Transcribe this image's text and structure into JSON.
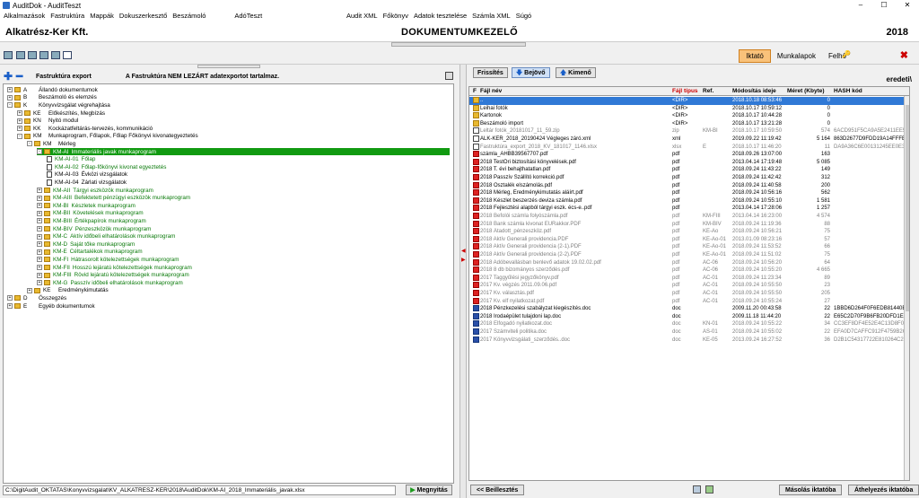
{
  "window": {
    "title": "AuditDok - AuditTeszt",
    "min": "–",
    "max": "☐",
    "close": "✕"
  },
  "menu": {
    "left": [
      "Alkalmazások",
      "Fastruktúra",
      "Mappák",
      "Dokuszerkesztő",
      "Beszámoló",
      "AdóTeszt"
    ],
    "right": [
      "Audit XML",
      "Főkönyv",
      "Adatok tesztelése",
      "Számla XML",
      "Súgó"
    ]
  },
  "header": {
    "company": "Alkatrész-Ker Kft.",
    "module": "DOKUMENTUMKEZELŐ",
    "year": "2018"
  },
  "tabs": [
    "Iktató",
    "Munkalapok",
    "Felhő"
  ],
  "left": {
    "label": "Fastruktúra export",
    "notice": "A Fastruktúra NEM LEZÁRT adatexportot tartalmaz.",
    "path": "C:\\DigitAudit_OKTATAS\\Konyvvizsgalat\\KV_ALKATRESZ-KER\\2018\\AuditDok\\KM-AI_2018_Immateriális_javak.xlsx",
    "open": "Megnyitás"
  },
  "tree": [
    {
      "lvl": 0,
      "exp": "+",
      "code": "A",
      "label": "Állandó dokumentumok"
    },
    {
      "lvl": 0,
      "exp": "+",
      "code": "B",
      "label": "Beszámoló és elemzés"
    },
    {
      "lvl": 0,
      "exp": "-",
      "code": "K",
      "label": "Könyvvizsgálat végrehajtása"
    },
    {
      "lvl": 1,
      "exp": "+",
      "code": "KE",
      "label": "Előkészítés, Megbízás"
    },
    {
      "lvl": 1,
      "exp": "+",
      "code": "KN",
      "label": "Nyitó modul"
    },
    {
      "lvl": 1,
      "exp": "+",
      "code": "KK",
      "label": "Kockázatfeltárás-tervezés, kommunikáció"
    },
    {
      "lvl": 1,
      "exp": "-",
      "code": "KM",
      "label": "Munkaprogram, Főlapok, Főlap Főkönyvi kivonategyeztetés"
    },
    {
      "lvl": 2,
      "exp": "-",
      "code": "KM",
      "label": "Mérleg"
    },
    {
      "lvl": 3,
      "exp": "-",
      "code": "KM-AI",
      "label": "Immateriális javak munkaprogram",
      "sel": true
    },
    {
      "lvl": 4,
      "doc": true,
      "code": "KM-AI-01",
      "label": "Főlap",
      "green": true
    },
    {
      "lvl": 4,
      "doc": true,
      "code": "KM-AI-02",
      "label": "Főlap-főkönyvi kivonat egyeztetés",
      "green": true
    },
    {
      "lvl": 4,
      "doc": true,
      "code": "KM-AI-03",
      "label": "Évközi vizsgálatok"
    },
    {
      "lvl": 4,
      "doc": true,
      "code": "KM-AI-04",
      "label": "Zárlati vizsgálatok"
    },
    {
      "lvl": 3,
      "exp": "+",
      "code": "KM-AII",
      "label": "Tárgyi eszközök munkaprogram",
      "green": true
    },
    {
      "lvl": 3,
      "exp": "+",
      "code": "KM-AIII",
      "label": "Befektetett pénzügyi eszközök munkaprogram",
      "green": true
    },
    {
      "lvl": 3,
      "exp": "+",
      "code": "KM-BI",
      "label": "Készletek munkaprogram",
      "green": true
    },
    {
      "lvl": 3,
      "exp": "+",
      "code": "KM-BII",
      "label": "Követelések munkaprogram",
      "green": true
    },
    {
      "lvl": 3,
      "exp": "+",
      "code": "KM-BIII",
      "label": "Értékpapírok munkaprogram",
      "green": true
    },
    {
      "lvl": 3,
      "exp": "+",
      "code": "KM-BIV",
      "label": "Pénzeszközök munkaprogram",
      "green": true
    },
    {
      "lvl": 3,
      "exp": "+",
      "code": "KM-C",
      "label": "Aktív időbeli elhatárolások munkaprogram",
      "green": true
    },
    {
      "lvl": 3,
      "exp": "+",
      "code": "KM-D",
      "label": "Saját tőke munkaprogram",
      "green": true
    },
    {
      "lvl": 3,
      "exp": "+",
      "code": "KM-E",
      "label": "Céltartalékok munkaprogram",
      "green": true
    },
    {
      "lvl": 3,
      "exp": "+",
      "code": "KM-FI",
      "label": "Hátrasorolt kötelezettségek munkaprogram",
      "green": true
    },
    {
      "lvl": 3,
      "exp": "+",
      "code": "KM-FII",
      "label": "Hosszú lejáratú kötelezettségek munkaprogram",
      "green": true
    },
    {
      "lvl": 3,
      "exp": "+",
      "code": "KM-FIII",
      "label": "Rövid lejáratú kötelezettségek munkaprogram",
      "green": true
    },
    {
      "lvl": 3,
      "exp": "+",
      "code": "KM-G",
      "label": "Passzív időbeli elhatárolások munkaprogram",
      "green": true
    },
    {
      "lvl": 2,
      "exp": "+",
      "code": "KE",
      "label": "Eredménykimutatás"
    },
    {
      "lvl": 0,
      "exp": "+",
      "code": "D",
      "label": "Összegzés"
    },
    {
      "lvl": 0,
      "exp": "+",
      "code": "E",
      "label": "Egyéb dokumentumok"
    }
  ],
  "right": {
    "refresh": "Frissítés",
    "incoming": "Bejövő",
    "outgoing": "Kimenő",
    "original": "eredeti\\",
    "back": "<< Beillesztés",
    "copy": "Másolás iktatóba",
    "move": "Áthelyezés iktatóba"
  },
  "columns": [
    "F",
    "Fájl név",
    "Fájl típus",
    "Ref.",
    "Módosítás ideje",
    "Méret (Kbyte)",
    "HASH kód"
  ],
  "files": [
    {
      "ic": "up",
      "name": "..",
      "type": "<DIR>",
      "ref": "",
      "date": "2018.10.18 08:53:46",
      "size": "0",
      "hash": "",
      "sel": true
    },
    {
      "ic": "folder",
      "name": "Leihai fotók",
      "type": "<DIR>",
      "ref": "",
      "date": "2018.10.17 10:59:12",
      "size": "0",
      "hash": ""
    },
    {
      "ic": "folder",
      "name": "Kartonok",
      "type": "<DIR>",
      "ref": "",
      "date": "2018.10.17 10:44:28",
      "size": "0",
      "hash": ""
    },
    {
      "ic": "folder",
      "name": "Beszámoló import",
      "type": "<DIR>",
      "ref": "",
      "date": "2018.10.17 13:21:28",
      "size": "0",
      "hash": ""
    },
    {
      "ic": "xml",
      "name": "Leltár fotók_20181017_11_59.zip",
      "type": "zip",
      "ref": "KM-BI",
      "date": "2018.10.17 10:59:50",
      "size": "574",
      "hash": "6ACD951F5CA9A5E2411EE56",
      "gray": true
    },
    {
      "ic": "xml",
      "name": "ALK-KER_2018_20190424 Végleges záró.xml",
      "type": "xml",
      "ref": "",
      "date": "2019.09.22 11:19:42",
      "size": "5 164",
      "hash": "863D2677D9FDD19A14FFFBFB"
    },
    {
      "ic": "xml",
      "name": "Fastruktúra_export_2018_KV_181017_1146.xlsx",
      "type": "xlsx",
      "ref": "E",
      "date": "2018.10.17 11:46:20",
      "size": "11",
      "hash": "DA9A36C6E00131245EE0E3F",
      "gray": true
    },
    {
      "ic": "pdf",
      "name": "számla_AHBB39567707.pdf",
      "type": "pdf",
      "ref": "",
      "date": "2018.09.26 13:07:00",
      "size": "163",
      "hash": ""
    },
    {
      "ic": "pdf",
      "name": "2018 TestÖri biztosítási könyvelések.pdf",
      "type": "pdf",
      "ref": "",
      "date": "2013.04.14 17:19:48",
      "size": "5 085",
      "hash": ""
    },
    {
      "ic": "pdf",
      "name": "2018 T. évi behajthatatlan.pdf",
      "type": "pdf",
      "ref": "",
      "date": "2018.09.24 11:43:22",
      "size": "149",
      "hash": ""
    },
    {
      "ic": "pdf",
      "name": "2018 Passzív Szállító korrekció.pdf",
      "type": "pdf",
      "ref": "",
      "date": "2018.09.24 11:42:42",
      "size": "312",
      "hash": ""
    },
    {
      "ic": "pdf",
      "name": "2018 Osztalék elszámolás.pdf",
      "type": "pdf",
      "ref": "",
      "date": "2018.09.24 11:40:58",
      "size": "200",
      "hash": ""
    },
    {
      "ic": "pdf",
      "name": "2018 Mérleg, Eredménykimutatás aláírt.pdf",
      "type": "pdf",
      "ref": "",
      "date": "2018.09.24 10:56:16",
      "size": "562",
      "hash": ""
    },
    {
      "ic": "pdf",
      "name": "2018 Készlet beszerzés deviza számla.pdf",
      "type": "pdf",
      "ref": "",
      "date": "2018.09.24 10:55:10",
      "size": "1 581",
      "hash": ""
    },
    {
      "ic": "pdf",
      "name": "2018 Fejlesztési alapból tárgyi eszk. écs-e..pdf",
      "type": "pdf",
      "ref": "",
      "date": "2013.04.14 17:28:06",
      "size": "1 257",
      "hash": ""
    },
    {
      "ic": "pdf",
      "name": "2018 Befolói számla folyószámla.pdf",
      "type": "pdf",
      "ref": "KM-FIII",
      "date": "2013.04.14 16:23:00",
      "size": "4 574",
      "hash": "",
      "gray": true
    },
    {
      "ic": "pdf",
      "name": "2018 Bank számla kivonat EURakkor.PDF",
      "type": "pdf",
      "ref": "KM-BIV",
      "date": "2018.09.24 11:19:36",
      "size": "88",
      "hash": "",
      "gray": true
    },
    {
      "ic": "pdf",
      "name": "2018 Átadott_pénzeszköz.pdf",
      "type": "pdf",
      "ref": "KE-Ao",
      "date": "2018.09.24 10:56:21",
      "size": "75",
      "hash": "",
      "gray": true
    },
    {
      "ic": "pdf",
      "name": "2018 Aktív Generali providencia.PDF",
      "type": "pdf",
      "ref": "KE-Ao-01",
      "date": "2013.01.09 08:23:16",
      "size": "57",
      "hash": "",
      "gray": true
    },
    {
      "ic": "pdf",
      "name": "2018 Aktív Generali providencia (2-1).PDF",
      "type": "pdf",
      "ref": "KE-Ao-01",
      "date": "2018.09.24 11:53:52",
      "size": "66",
      "hash": "",
      "gray": true
    },
    {
      "ic": "pdf",
      "name": "2018 Aktív Generali providencia (2-2).PDF",
      "type": "pdf",
      "ref": "KE-Ao-01",
      "date": "2018.09.24 11:51:02",
      "size": "75",
      "hash": "",
      "gray": true
    },
    {
      "ic": "pdf",
      "name": "2018 Adóbevallásban benlevő adatok 19.02.02.pdf",
      "type": "pdf",
      "ref": "AC-06",
      "date": "2018.09.24 10:56:20",
      "size": "64",
      "hash": "",
      "gray": true
    },
    {
      "ic": "pdf",
      "name": "2018 8 db bizományos szerződés.pdf",
      "type": "pdf",
      "ref": "AC-06",
      "date": "2018.09.24 10:55:20",
      "size": "4 665",
      "hash": "",
      "gray": true
    },
    {
      "ic": "pdf",
      "name": "2017 Taggyűlési jegyzőkönyv.pdf",
      "type": "pdf",
      "ref": "AC-01",
      "date": "2018.09.24 11:23:34",
      "size": "89",
      "hash": "",
      "gray": true
    },
    {
      "ic": "pdf",
      "name": "2017 Kv. végzés 2011.09.06.pdf",
      "type": "pdf",
      "ref": "AC-01",
      "date": "2018.09.24 10:55:50",
      "size": "23",
      "hash": "",
      "gray": true
    },
    {
      "ic": "pdf",
      "name": "2017 Kv. választás.pdf",
      "type": "pdf",
      "ref": "AC-01",
      "date": "2018.09.24 10:55:50",
      "size": "205",
      "hash": "",
      "gray": true
    },
    {
      "ic": "pdf",
      "name": "2017 Kv. elf nyilatkozat.pdf",
      "type": "pdf",
      "ref": "AC-01",
      "date": "2018.09.24 10:55:24",
      "size": "27",
      "hash": "",
      "gray": true
    },
    {
      "ic": "docx",
      "name": "2018 Pénzkezelési szabályzat kiegészítés.doc",
      "type": "doc",
      "ref": "",
      "date": "2009.11.20 00:43:58",
      "size": "22",
      "hash": "1BBD6D264F0F6EDB81440E2"
    },
    {
      "ic": "docx",
      "name": "2018 Irodaépület tulajdoni lap.doc",
      "type": "doc",
      "ref": "",
      "date": "2009.11.18 11:44:20",
      "size": "22",
      "hash": "E65C2D70F9B6FB20DFD1E6F3"
    },
    {
      "ic": "docx",
      "name": "2018 Elfogadó nyilatkozat.doc",
      "type": "doc",
      "ref": "KN-01",
      "date": "2018.09.24 10:55:22",
      "size": "34",
      "hash": "CC3EF8DF4E52E4C13D8F0E3",
      "gray": true
    },
    {
      "ic": "docx",
      "name": "2017 Számviteli politika.doc",
      "type": "doc",
      "ref": "AS-01",
      "date": "2018.09.24 10:55:02",
      "size": "22",
      "hash": "EFA0D7CAFFC912F4759B2CE",
      "gray": true
    },
    {
      "ic": "docx",
      "name": "2017 Könyvvizsgálati_szerződés..doc",
      "type": "doc",
      "ref": "KE-05",
      "date": "2013.09.24 16:27:52",
      "size": "36",
      "hash": "D2B1C54317722E810264C2D0",
      "gray": true
    }
  ]
}
